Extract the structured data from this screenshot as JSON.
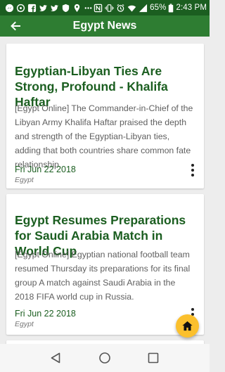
{
  "status_bar": {
    "notification_icons": [
      "facebook-messenger-icon",
      "whatsapp-icon",
      "facebook-icon",
      "twitter-icon",
      "twitter-icon",
      "shield-icon",
      "location-pin-icon",
      "more-dots-icon"
    ],
    "system_icons": [
      "nfc-icon",
      "vibrate-icon",
      "alarm-icon",
      "wifi-icon",
      "signal-icon"
    ],
    "battery": "65%",
    "time": "2:43 PM"
  },
  "app_bar": {
    "title": "Egypt News",
    "back_icon": "arrow-back-icon"
  },
  "articles": [
    {
      "title": "Egyptian-Libyan Ties Are Strong, Profound - Khalifa Haftar",
      "summary": "[Egypt Online] The Commander-in-Chief of the Libyan Army Khalifa Haftar praised the depth and strength of the Egyptian-Libyan ties, adding that both countries share common fate relationship.",
      "date": "Fri Jun 22 2018",
      "source": "Egypt"
    },
    {
      "title": "Egypt Resumes Preparations for Saudi Arabia Match in World Cup",
      "summary": "[Egypt Online] Egyptian national football team resumed Thursday its preparations for its final group A match against Saudi Arabia in the 2018 FIFA world cup in Russia.",
      "date": "Fri Jun 22 2018",
      "source": "Egypt"
    }
  ],
  "fab": {
    "icon": "home-icon"
  },
  "nav_bar": {
    "icons": [
      "back-triangle-icon",
      "home-circle-icon",
      "recents-square-icon"
    ]
  },
  "colors": {
    "status_bar": "#1b5e20",
    "app_bar": "#2e7d32",
    "title_text": "#1b5e20",
    "fab": "#fbc02d"
  }
}
